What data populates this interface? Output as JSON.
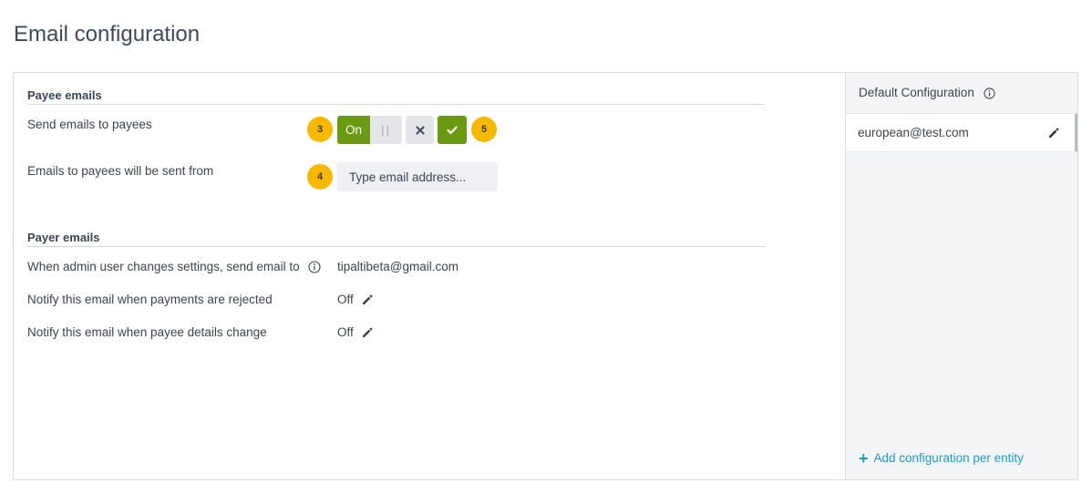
{
  "page": {
    "title": "Email configuration"
  },
  "payee_emails": {
    "section_title": "Payee emails",
    "send_label": "Send emails to payees",
    "badge_toggle": "3",
    "toggle_on_label": "On",
    "toggle_knob": "||",
    "cancel_icon": "close-icon",
    "confirm_icon": "check-icon",
    "badge_confirm": "5",
    "from_label": "Emails to payees will be sent from",
    "badge_input": "4",
    "from_placeholder": "Type email address...",
    "from_value": ""
  },
  "payer_emails": {
    "section_title": "Payer emails",
    "admin_label": "When admin user changes settings, send email to",
    "admin_value": "tipaltibeta@gmail.com",
    "rejected_label": "Notify this email when payments are rejected",
    "rejected_value": "Off",
    "details_label": "Notify this email when payee details change",
    "details_value": "Off"
  },
  "sidebar": {
    "header": "Default Configuration",
    "items": [
      {
        "label": "european@test.com"
      }
    ],
    "add_label": "Add configuration per entity"
  },
  "colors": {
    "accent_green": "#6a9a12",
    "badge_yellow": "#f6b800",
    "link_blue": "#1a9bd0",
    "text": "#3b4451"
  }
}
